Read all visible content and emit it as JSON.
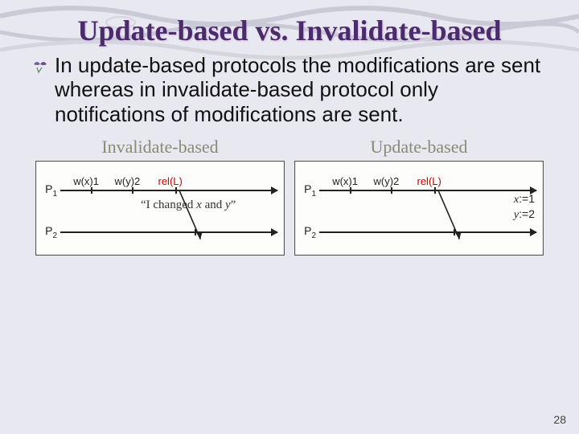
{
  "title": "Update-based vs. Invalidate-based",
  "body": "In update-based protocols the modifications are sent whereas in invalidate-based protocol only notifications of modifications are sent.",
  "left": {
    "heading": "Invalidate-based",
    "p1": "P",
    "p1sub": "1",
    "p2": "P",
    "p2sub": "2",
    "ev1": "w(x)1",
    "ev2": "w(y)2",
    "ev3": "rel(L)",
    "quote_open": "“I changed ",
    "quote_var1": "x",
    "quote_mid": " and ",
    "quote_var2": "y",
    "quote_close": "”"
  },
  "right": {
    "heading": "Update-based",
    "p1": "P",
    "p1sub": "1",
    "p2": "P",
    "p2sub": "2",
    "ev1": "w(x)1",
    "ev2": "w(y)2",
    "ev3": "rel(L)",
    "note_x_var": "x",
    "note_x_val": ":=1",
    "note_y_var": "y",
    "note_y_val": ":=2"
  },
  "page_number": "28"
}
